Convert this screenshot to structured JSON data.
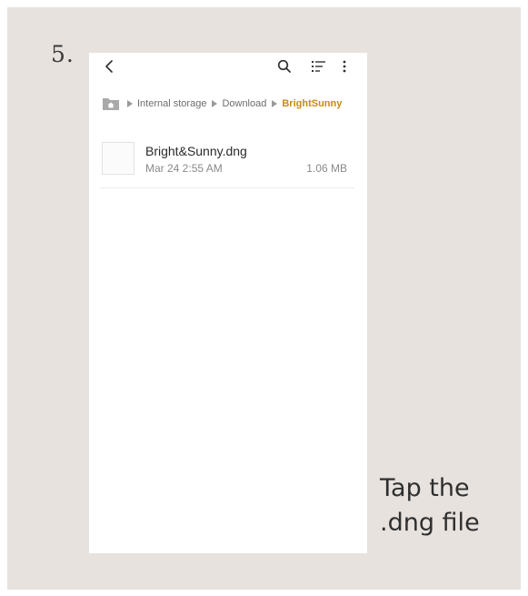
{
  "step": {
    "number": "5."
  },
  "phone": {
    "toolbar": {
      "back_icon": "chevron-left-icon",
      "search_icon": "search-icon",
      "sort_icon": "sort-list-icon",
      "more_icon": "more-vertical-icon"
    },
    "breadcrumb": {
      "home_icon": "home-folder-icon",
      "items": [
        "Internal storage",
        "Download",
        "BrightSunny"
      ],
      "active_color": "#c98a12"
    },
    "files": [
      {
        "name": "Bright&Sunny.dng",
        "date": "Mar 24 2:55 AM",
        "size": "1.06 MB"
      }
    ]
  },
  "instruction": {
    "line1": "Tap the",
    "line2": ".dng file"
  },
  "colors": {
    "background": "#e7e2de",
    "screen": "#ffffff",
    "accent": "#c98a12"
  }
}
